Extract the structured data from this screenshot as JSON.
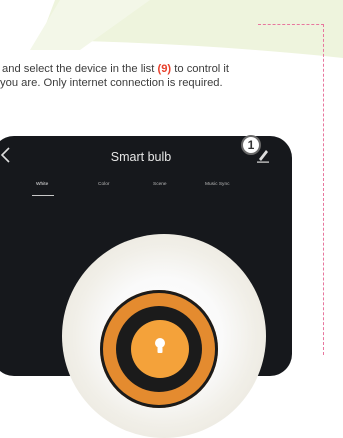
{
  "instructions": {
    "line1_prefix": "and select the device in the list ",
    "line1_ref": "(9)",
    "line1_suffix": " to control it",
    "line2": "you are. Only internet connection is required."
  },
  "app": {
    "title": "Smart bulb",
    "tabs": [
      "White",
      "Color",
      "Scene",
      "Music Sync"
    ],
    "active_tab": "White"
  },
  "callout": {
    "number": "1"
  },
  "colors": {
    "accent_red": "#e8412c",
    "dial_orange": "#e48b2f",
    "phone_bg": "#16181c",
    "dotted_border": "#e8769e"
  }
}
